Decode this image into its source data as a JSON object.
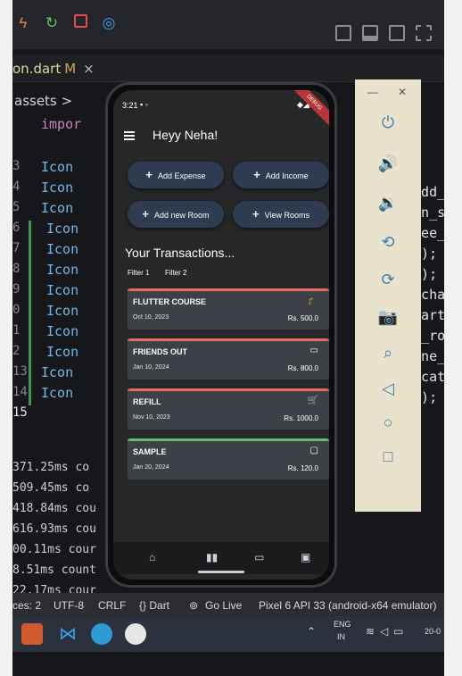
{
  "ide": {
    "tab": {
      "name": "on.dart",
      "modified": "M",
      "close": "×"
    },
    "breadcrumb": {
      "folder": "assets",
      "separator": ">",
      "next": "impor"
    },
    "line_numbers": [
      "3",
      "4",
      "5",
      "6",
      "7",
      "8",
      "9",
      "0",
      "1",
      "2",
      "13",
      "14",
      "15"
    ],
    "code_lines": [
      "Icon",
      "Icon",
      "Icon",
      "Icon",
      "Icon",
      "Icon",
      "Icon",
      "Icon",
      "Icon",
      "Icon",
      "Icon",
      "Icon",
      ""
    ],
    "right_code": [
      "_add_",
      "son_s",
      "upee_r",
      "ed);",
      "ed);",
      "r_char",
      "chart_r",
      "le_rour",
      "line_ro",
      "licatio",
      "gs);"
    ],
    "terminal": [
      "371.25ms co",
      "509.45ms co",
      "418.84ms cou",
      "616.93ms cou",
      "00.11ms cour",
      "8.51ms count",
      "22.17ms cour"
    ],
    "statusbar": {
      "spaces": "ces: 2",
      "encoding": "UTF-8",
      "eol": "CRLF",
      "lang": "{} Dart",
      "golive": "Go Live",
      "device": "Pixel 6 API 33 (android-x64 emulator)"
    },
    "taskbar": {
      "lang": "ENG",
      "region": "IN",
      "time": "20-0"
    }
  },
  "phone": {
    "time": "3:21",
    "debug_banner": "DEBUG",
    "greeting": "Heyy Neha!",
    "buttons": [
      "Add Expense",
      "Add Income",
      "Add new Room",
      "View Rooms"
    ],
    "transactions_title": "Your Transactions...",
    "filters": [
      "Filter 1",
      "Filter 2"
    ],
    "transactions": [
      {
        "name": "FLUTTER COURSE",
        "date": "Oct 10, 2023",
        "amount": "Rs. 500.0",
        "color": "#e56c5f",
        "icon": "graduation-cap-icon",
        "glyph": "🎓"
      },
      {
        "name": "FRIENDS OUT",
        "date": "Jan 10, 2024",
        "amount": "Rs. 800.0",
        "color": "#e56c5f",
        "icon": "calendar-icon",
        "glyph": "▭"
      },
      {
        "name": "REFILL",
        "date": "Nov 10, 2023",
        "amount": "Rs. 1000.0",
        "color": "#e56c5f",
        "icon": "shopping-cart-icon",
        "glyph": "🛒"
      },
      {
        "name": "SAMPLE",
        "date": "Jan 20, 2024",
        "amount": "Rs. 120.0",
        "color": "#5fbf6a",
        "icon": "briefcase-icon",
        "glyph": "▢"
      }
    ]
  }
}
